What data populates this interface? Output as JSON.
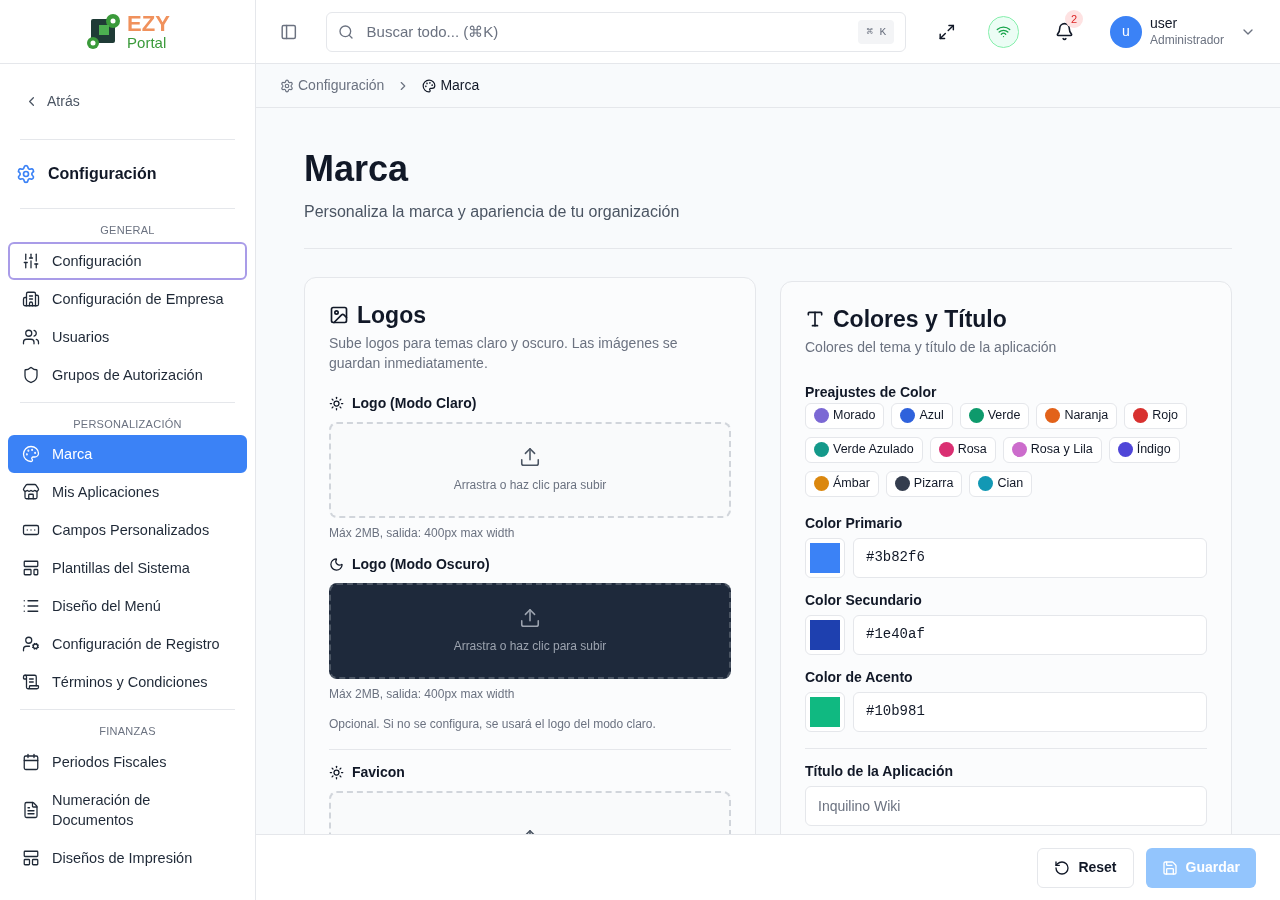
{
  "brand": {
    "name_top": "EZY",
    "name_bottom": "Portal"
  },
  "header": {
    "search_placeholder": "Buscar todo... (⌘K)",
    "shortcut": "⌘ K",
    "notifications": "2",
    "user": {
      "initial": "u",
      "name": "user",
      "role": "Administrador"
    }
  },
  "breadcrumb": [
    {
      "label": "Configuración",
      "current": false
    },
    {
      "label": "Marca",
      "current": true
    }
  ],
  "sidebar": {
    "back": "Atrás",
    "title": "Configuración",
    "sections": [
      {
        "heading": "GENERAL",
        "items": [
          {
            "label": "Configuración",
            "selected": false,
            "focused": true
          },
          {
            "label": "Configuración de Empresa",
            "selected": false,
            "focused": false
          },
          {
            "label": "Usuarios",
            "selected": false,
            "focused": false
          },
          {
            "label": "Grupos de Autorización",
            "selected": false,
            "focused": false
          }
        ]
      },
      {
        "heading": "PERSONALIZACIÓN",
        "items": [
          {
            "label": "Marca",
            "selected": true,
            "focused": false
          },
          {
            "label": "Mis Aplicaciones",
            "selected": false,
            "focused": false
          },
          {
            "label": "Campos Personalizados",
            "selected": false,
            "focused": false
          },
          {
            "label": "Plantillas del Sistema",
            "selected": false,
            "focused": false
          },
          {
            "label": "Diseño del Menú",
            "selected": false,
            "focused": false
          },
          {
            "label": "Configuración de Registro",
            "selected": false,
            "focused": false
          },
          {
            "label": "Términos y Condiciones",
            "selected": false,
            "focused": false
          }
        ]
      },
      {
        "heading": "FINANZAS",
        "items": [
          {
            "label": "Periodos Fiscales",
            "selected": false,
            "focused": false
          },
          {
            "label": "Numeración de Documentos",
            "selected": false,
            "focused": false
          },
          {
            "label": "Diseños de Impresión",
            "selected": false,
            "focused": false
          }
        ]
      }
    ]
  },
  "page": {
    "title": "Marca",
    "subtitle": "Personaliza la marca y apariencia de tu organización"
  },
  "logos": {
    "title": "Logos",
    "description": "Sube logos para temas claro y oscuro. Las imágenes se guardan inmediatamente.",
    "uploads": [
      {
        "label": "Logo (Modo Claro)",
        "kind": "light",
        "hint": "Arrastra o haz clic para subir",
        "note": "Máx 2MB, salida: 400px max width"
      },
      {
        "label": "Logo (Modo Oscuro)",
        "kind": "dark",
        "hint": "Arrastra o haz clic para subir",
        "note": "Máx 2MB, salida: 400px max width",
        "extra": "Opcional. Si no se configura, se usará el logo del modo claro."
      },
      {
        "label": "Favicon",
        "kind": "light"
      }
    ]
  },
  "colors": {
    "title": "Colores y Título",
    "description": "Colores del tema y título de la aplicación",
    "presets_label": "Preajustes de Color",
    "presets": [
      {
        "label": "Morado",
        "color": "#7b68d4"
      },
      {
        "label": "Azul",
        "color": "#2f62dc"
      },
      {
        "label": "Verde",
        "color": "#0e9a6c"
      },
      {
        "label": "Naranja",
        "color": "#e2621a"
      },
      {
        "label": "Rojo",
        "color": "#d8312f"
      },
      {
        "label": "Verde Azulado",
        "color": "#14998a"
      },
      {
        "label": "Rosa",
        "color": "#da2f72"
      },
      {
        "label": "Rosa y Lila",
        "color": "#cc6ccc"
      },
      {
        "label": "Índigo",
        "color": "#4f46d8"
      },
      {
        "label": "Ámbar",
        "color": "#db870e"
      },
      {
        "label": "Pizarra",
        "color": "#343d4e"
      },
      {
        "label": "Cian",
        "color": "#1298b4"
      }
    ],
    "fields": [
      {
        "label": "Color Primario",
        "value": "#3b82f6",
        "color": "#3b82f6"
      },
      {
        "label": "Color Secundario",
        "value": "#1e40af",
        "color": "#1e40af"
      },
      {
        "label": "Color de Acento",
        "value": "#10b981",
        "color": "#10b981"
      }
    ],
    "app_title": {
      "label": "Título de la Aplicación",
      "placeholder": "Inquilino Wiki"
    }
  },
  "footer": {
    "reset": "Reset",
    "save": "Guardar",
    "save_disabled": true
  }
}
